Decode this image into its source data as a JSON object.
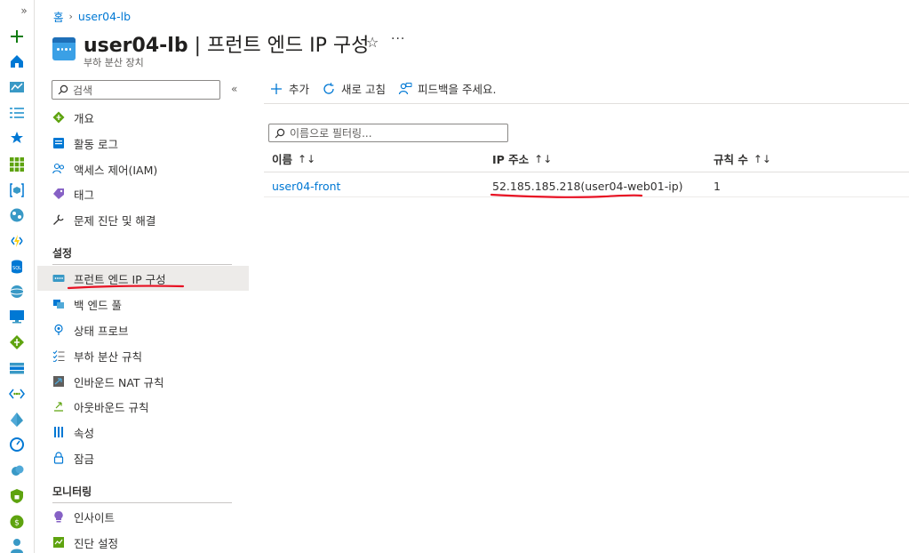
{
  "breadcrumb": {
    "home": "홈",
    "resource": "user04-lb"
  },
  "header": {
    "resource_name": "user04-lb",
    "page_name": "| 프런트 엔드 IP 구성",
    "subtitle": "부하 분산 장치",
    "star": "☆",
    "more": "···"
  },
  "nav": {
    "search_placeholder": "검색",
    "collapse": "«",
    "items": [
      {
        "label": "개요",
        "icon": "overview-icon"
      },
      {
        "label": "활동 로그",
        "icon": "activity-log-icon"
      },
      {
        "label": "액세스 제어(IAM)",
        "icon": "iam-icon"
      },
      {
        "label": "태그",
        "icon": "tag-icon"
      },
      {
        "label": "문제 진단 및 해결",
        "icon": "wrench-icon"
      }
    ],
    "settings_title": "설정",
    "settings_items": [
      {
        "label": "프런트 엔드 IP 구성",
        "icon": "frontend-ip-icon",
        "active": true
      },
      {
        "label": "백 엔드 풀",
        "icon": "backend-pool-icon"
      },
      {
        "label": "상태 프로브",
        "icon": "health-probe-icon"
      },
      {
        "label": "부하 분산 규칙",
        "icon": "lb-rules-icon"
      },
      {
        "label": "인바운드 NAT 규칙",
        "icon": "inbound-nat-icon"
      },
      {
        "label": "아웃바운드 규칙",
        "icon": "outbound-rules-icon"
      },
      {
        "label": "속성",
        "icon": "properties-icon"
      },
      {
        "label": "잠금",
        "icon": "lock-icon"
      }
    ],
    "monitoring_title": "모니터링",
    "monitoring_items": [
      {
        "label": "인사이트",
        "icon": "insights-icon"
      },
      {
        "label": "진단 설정",
        "icon": "diagnostic-settings-icon"
      }
    ]
  },
  "toolbar": {
    "add": "추가",
    "refresh": "새로 고침",
    "feedback": "피드백을 주세요."
  },
  "filter": {
    "placeholder": "이름으로 필터링..."
  },
  "table": {
    "columns": [
      "이름",
      "IP 주소",
      "규칙 수"
    ],
    "sort_glyph": "↑↓",
    "rows": [
      {
        "name": "user04-front",
        "ip": "52.185.185.218(user04-web01-ip)",
        "rules": "1"
      }
    ]
  },
  "rail": {
    "expand": "»"
  },
  "colors": {
    "accent": "#0078d4",
    "annotation": "#e81123"
  }
}
